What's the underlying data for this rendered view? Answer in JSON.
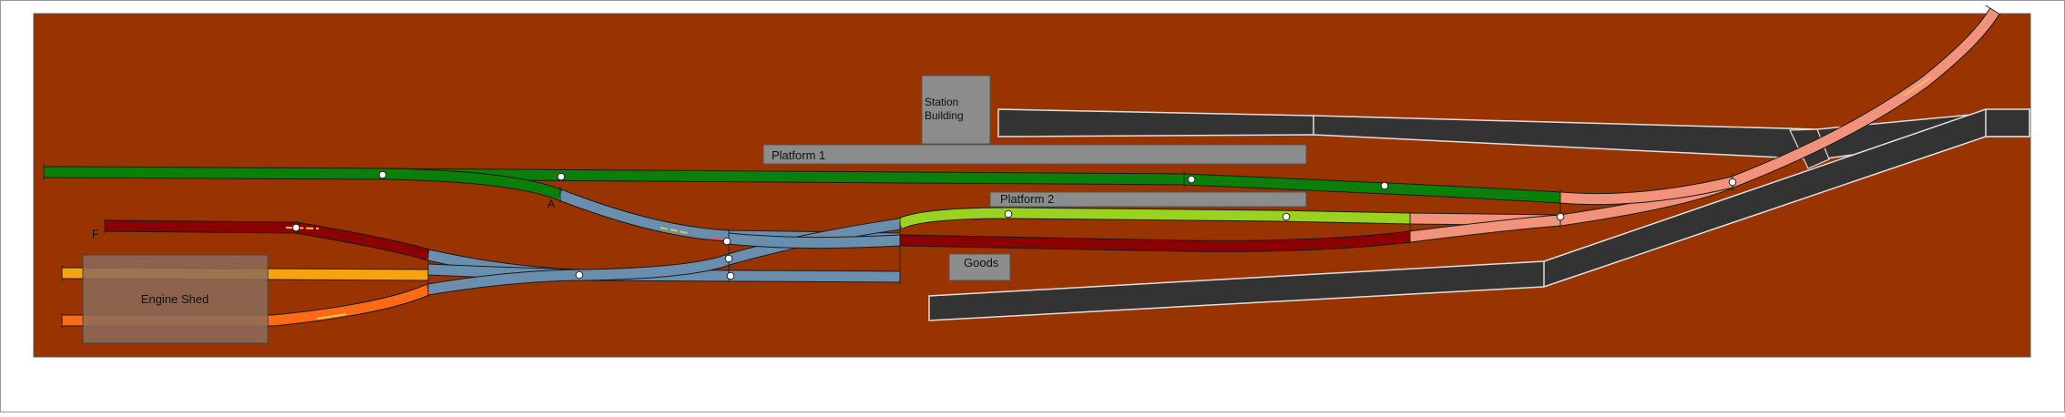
{
  "colors": {
    "page": "#ffffff",
    "baseboard": "#993300",
    "track_green": "#0a7f0a",
    "track_blue": "#6a8fae",
    "track_maroon": "#8b0000",
    "track_lime": "#99d21f",
    "track_salmon": "#f3927a",
    "track_orange": "#f5a30f",
    "track_orange2": "#ff6a16",
    "road": "#333333",
    "platform": "#8c8c8c",
    "building": "#8c8c8c",
    "engine_shed": "#8c6c5a"
  },
  "labels": {
    "station_line1": "Station",
    "station_line2": "Building",
    "platform1": "Platform 1",
    "platform2": "Platform 2",
    "goods": "Goods",
    "engine_shed": "Engine Shed",
    "marker_a": "A",
    "marker_f": "F"
  }
}
